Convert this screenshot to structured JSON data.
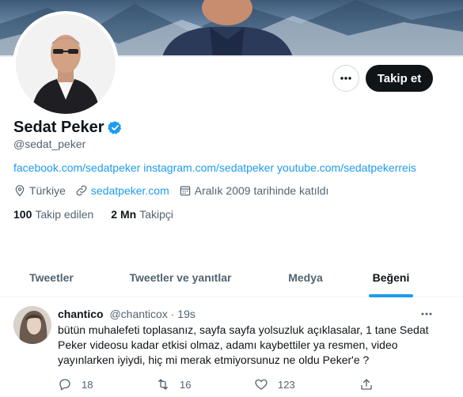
{
  "profile": {
    "name": "Sedat Peker",
    "handle": "@sedat_peker",
    "bio_links": "facebook.com/sedatpeker instagram.com/sedatpeker youtube.com/sedatpekerreis",
    "location": "Türkiye",
    "website": "sedatpeker.com",
    "joined": "Aralık 2009 tarihinde katıldı",
    "following_count": "100",
    "following_label": "Takip edilen",
    "followers_count": "2 Mn",
    "followers_label": "Takipçi",
    "follow_button": "Takip et",
    "verified": true
  },
  "tabs": [
    {
      "label": "Tweetler",
      "active": false
    },
    {
      "label": "Tweetler ve yanıtlar",
      "active": false
    },
    {
      "label": "Medya",
      "active": false
    },
    {
      "label": "Beğeni",
      "active": true
    }
  ],
  "tweet": {
    "author": "chantico",
    "handle": "@chanticox",
    "time": "19s",
    "separator": "·",
    "text": "bütün muhalefeti toplasanız, sayfa sayfa yolsuzluk açıklasalar, 1 tane Sedat Peker videosu kadar etkisi olmaz, adamı kaybettiler ya resmen, video yayınlarken iyiydi, hiç mi merak etmiyorsunuz ne oldu Peker'e ?",
    "replies": "18",
    "retweets": "16",
    "likes": "123"
  },
  "colors": {
    "accent": "#1d9bf0",
    "text": "#0f1419",
    "secondary": "#536471",
    "button_dark": "#0f1419"
  },
  "icons": [
    "more-horizontal-icon",
    "verified-badge-icon",
    "location-pin-icon",
    "link-icon",
    "calendar-icon",
    "reply-icon",
    "retweet-icon",
    "like-heart-icon",
    "share-icon"
  ]
}
